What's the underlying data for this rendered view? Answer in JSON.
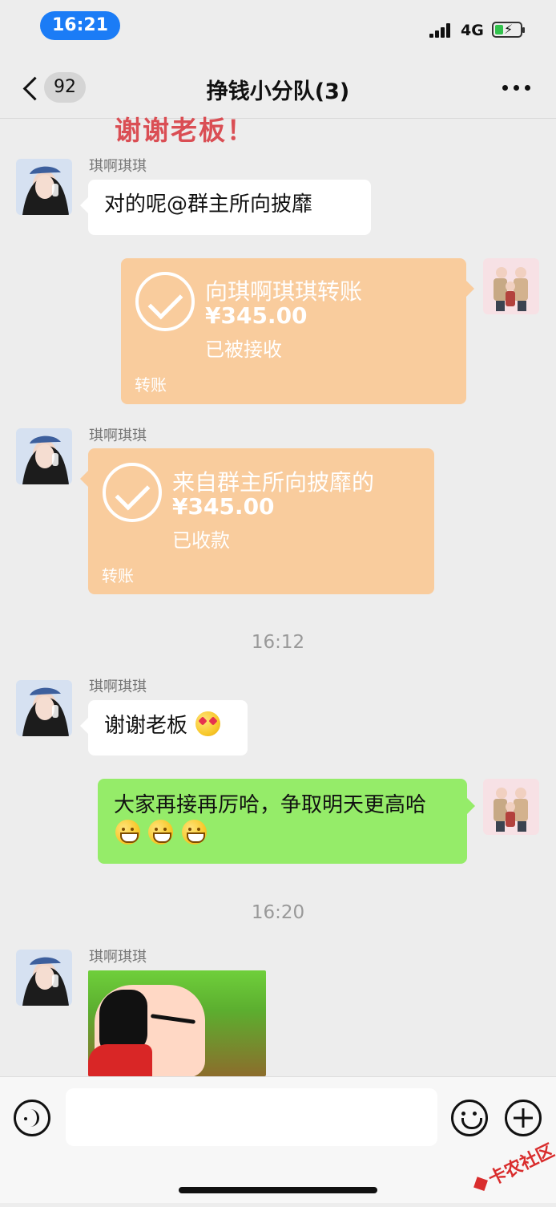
{
  "status_bar": {
    "time": "16:21",
    "network": "4G"
  },
  "nav": {
    "unread": "92",
    "title": "挣钱小分队(3)"
  },
  "partial_sticker_text": "谢谢老板！",
  "messages": [
    {
      "sender": "琪啊琪琪",
      "text": "对的呢@群主所向披靡"
    },
    {
      "transfer_out": {
        "title": "向琪啊琪琪转账",
        "amount": "¥345.00",
        "status": "已被接收",
        "label": "转账"
      }
    },
    {
      "sender": "琪啊琪琪",
      "transfer_in": {
        "title": "来自群主所向披靡的",
        "amount": "¥345.00",
        "status": "已收款",
        "label": "转账"
      }
    },
    {
      "time": "16:12"
    },
    {
      "sender": "琪啊琪琪",
      "text": "谢谢老板"
    },
    {
      "text": "大家再接再厉哈，争取明天更高哈"
    },
    {
      "time": "16:20"
    },
    {
      "sender": "琪啊琪琪"
    }
  ],
  "watermark": "卡农社区",
  "colors": {
    "accent": "#1b7cf6",
    "bubble_green": "#95ec69",
    "transfer": "#f9cc9d",
    "background": "#ededed"
  }
}
